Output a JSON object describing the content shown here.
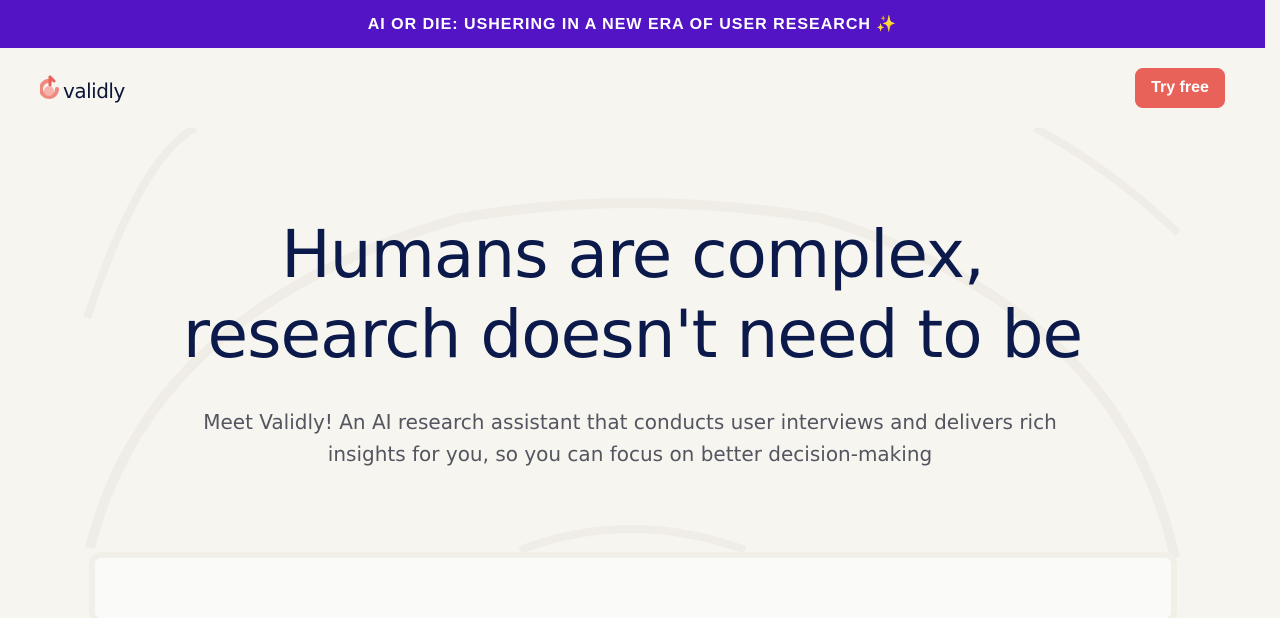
{
  "announcement": {
    "text": "AI OR DIE: USHERING IN A NEW ERA OF USER RESEARCH ✨"
  },
  "nav": {
    "logo_text": "validly",
    "try_button": "Try free"
  },
  "hero": {
    "title_line1": "Humans are complex,",
    "title_line2": "research doesn't need to be",
    "subtitle": "Meet Validly! An AI research assistant that conducts user interviews and delivers rich insights for you, so you can focus on better decision-making"
  },
  "colors": {
    "announcement_bg": "#5214c4",
    "accent": "#e8625a",
    "heading": "#0b1a4a",
    "background": "#f7f5f0"
  }
}
